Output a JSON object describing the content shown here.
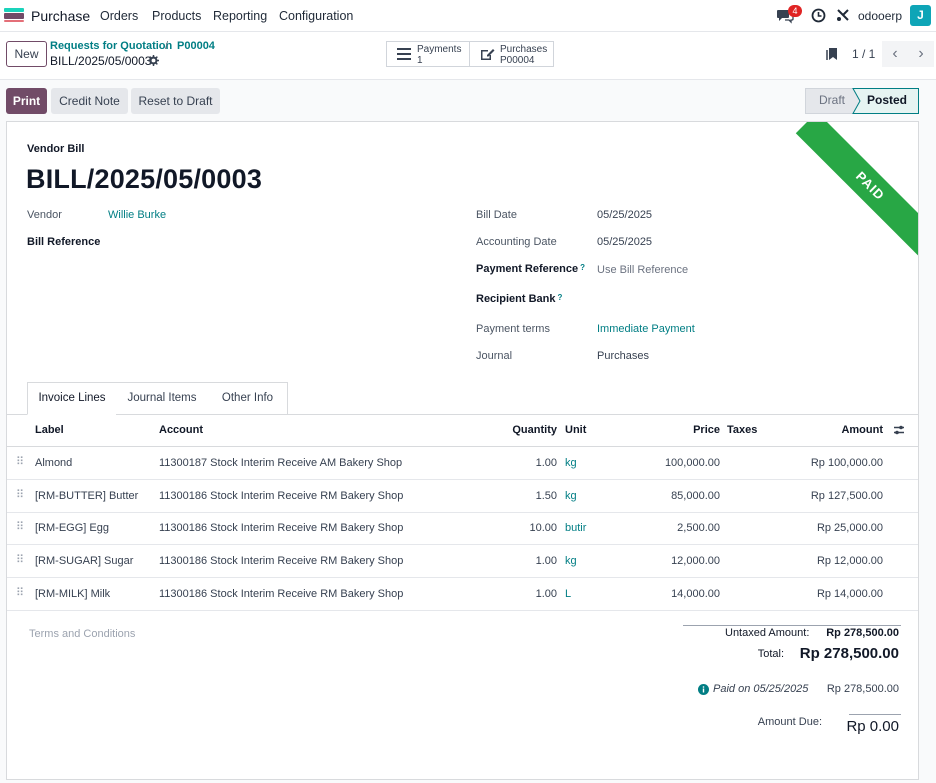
{
  "navbar": {
    "app_name": "Purchase",
    "menu": [
      "Orders",
      "Products",
      "Reporting",
      "Configuration"
    ],
    "messages_count": "4",
    "company": "odooerp",
    "user_initial": "J"
  },
  "control": {
    "new_label": "New",
    "breadcrumb_parent": "Requests for Quotation",
    "breadcrumb_sep": "/",
    "breadcrumb_current": "P00004",
    "record_name": "BILL/2025/05/0003",
    "smart_buttons": [
      {
        "label": "Payments",
        "value": "1"
      },
      {
        "label": "Purchases",
        "value": "P00004"
      }
    ],
    "pager": "1 / 1"
  },
  "actions": {
    "print": "Print",
    "credit_note": "Credit Note",
    "reset_draft": "Reset to Draft"
  },
  "statusbar": {
    "draft": "Draft",
    "posted": "Posted"
  },
  "sheet": {
    "ribbon": "PAID",
    "doc_type": "Vendor Bill",
    "title": "BILL/2025/05/0003",
    "left_fields": {
      "vendor_label": "Vendor",
      "vendor_value": "Willie Burke",
      "bill_ref_label": "Bill Reference"
    },
    "right_fields": {
      "bill_date_label": "Bill Date",
      "bill_date_value": "05/25/2025",
      "acc_date_label": "Accounting Date",
      "acc_date_value": "05/25/2025",
      "pay_ref_label": "Payment Reference",
      "pay_ref_placeholder": "Use Bill Reference",
      "recipient_bank_label": "Recipient Bank",
      "pay_terms_label": "Payment terms",
      "pay_terms_value": "Immediate Payment",
      "journal_label": "Journal",
      "journal_value": "Purchases",
      "help_mark": "?"
    },
    "tabs": [
      "Invoice Lines",
      "Journal Items",
      "Other Info"
    ],
    "columns": {
      "label": "Label",
      "account": "Account",
      "quantity": "Quantity",
      "unit": "Unit",
      "price": "Price",
      "taxes": "Taxes",
      "amount": "Amount"
    },
    "lines": [
      {
        "label": "Almond",
        "account": "11300187 Stock Interim Receive AM Bakery Shop",
        "quantity": "1.00",
        "unit": "kg",
        "price": "100,000.00",
        "taxes": "",
        "amount": "Rp 100,000.00"
      },
      {
        "label": "[RM-BUTTER] Butter",
        "account": "11300186 Stock Interim Receive RM Bakery Shop",
        "quantity": "1.50",
        "unit": "kg",
        "price": "85,000.00",
        "taxes": "",
        "amount": "Rp 127,500.00"
      },
      {
        "label": "[RM-EGG] Egg",
        "account": "11300186 Stock Interim Receive RM Bakery Shop",
        "quantity": "10.00",
        "unit": "butir",
        "price": "2,500.00",
        "taxes": "",
        "amount": "Rp 25,000.00"
      },
      {
        "label": "[RM-SUGAR] Sugar",
        "account": "11300186 Stock Interim Receive RM Bakery Shop",
        "quantity": "1.00",
        "unit": "kg",
        "price": "12,000.00",
        "taxes": "",
        "amount": "Rp 12,000.00"
      },
      {
        "label": "[RM-MILK] Milk",
        "account": "11300186 Stock Interim Receive RM Bakery Shop",
        "quantity": "1.00",
        "unit": "L",
        "price": "14,000.00",
        "taxes": "",
        "amount": "Rp 14,000.00"
      }
    ],
    "terms_placeholder": "Terms and Conditions",
    "totals": {
      "untaxed_label": "Untaxed Amount:",
      "untaxed_value": "Rp 278,500.00",
      "total_label": "Total:",
      "total_value": "Rp 278,500.00",
      "paid_on_label": "Paid on 05/25/2025",
      "paid_on_value": "Rp 278,500.00",
      "due_label": "Amount Due:",
      "due_value": "Rp 0.00"
    }
  },
  "colors": {
    "brand": "#714b67",
    "link": "#017e84",
    "paid_ribbon": "#28a745",
    "badge": "#e02424"
  }
}
